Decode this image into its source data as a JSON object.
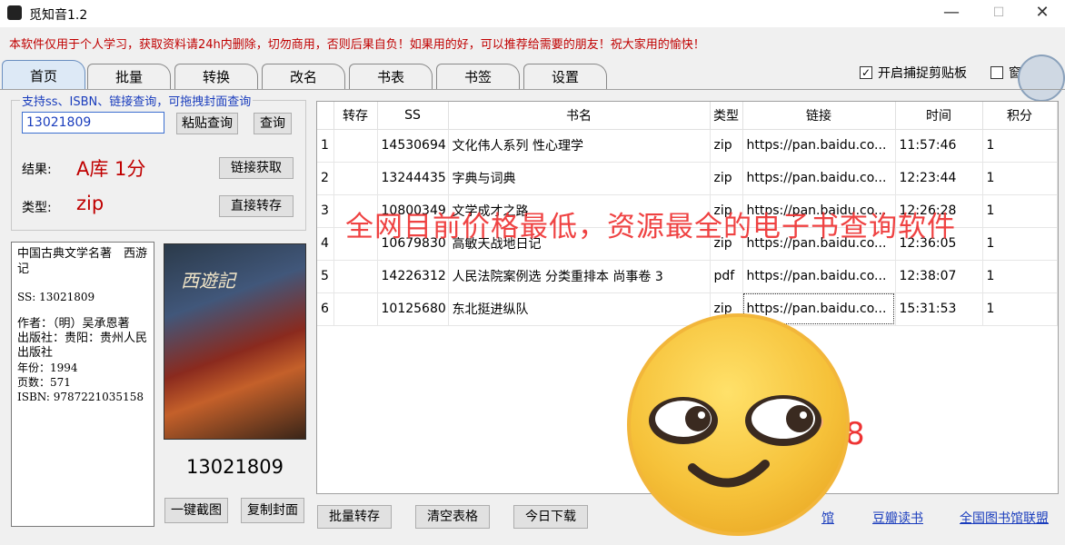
{
  "window": {
    "title": "觅知音1.2",
    "minimize": "—",
    "maximize": "☐",
    "close": "✕"
  },
  "notice": "本软件仅用于个人学习，获取资料请24h内删除，切勿商用，否则后果自负！如果用的好，可以推荐给需要的朋友！祝大家用的愉快！",
  "tabs": [
    {
      "label": "首页"
    },
    {
      "label": "批量"
    },
    {
      "label": "转换"
    },
    {
      "label": "改名"
    },
    {
      "label": "书表"
    },
    {
      "label": "书签"
    },
    {
      "label": "设置"
    }
  ],
  "top_options": {
    "capture_clipboard": "开启捕捉剪贴板",
    "capture_checked": "✓",
    "partial": "窗"
  },
  "query": {
    "legend": "支持ss、ISBN、链接查询，可拖拽封面查询",
    "input_value": "13021809",
    "paste_query": "粘贴查询",
    "query": "查询",
    "result_label": "结果:",
    "result_value": "A库 1分",
    "link_fetch": "链接获取",
    "type_label": "类型:",
    "type_value": "zip",
    "direct_save": "直接转存"
  },
  "book_info": {
    "title": "中国古典文学名著　西游记",
    "ss": "SS: 13021809",
    "author": "作者：（明）吴承恩著",
    "publisher": "出版社：贵阳：贵州人民出版社",
    "year": "年份：1994",
    "pages": "页数：571",
    "isbn": "ISBN: 9787221035158"
  },
  "cover": {
    "title": "西遊記",
    "number": "13021809",
    "screenshot": "一键截图",
    "copy_cover": "复制封面"
  },
  "table": {
    "headers": [
      "",
      "转存",
      "SS",
      "书名",
      "类型",
      "链接",
      "时间",
      "积分"
    ],
    "rows": [
      {
        "n": "1",
        "save": "",
        "ss": "14530694",
        "name": "文化伟人系列  性心理学",
        "type": "zip",
        "link": "https://pan.baidu.co...",
        "time": "11:57:46",
        "points": "1"
      },
      {
        "n": "2",
        "save": "",
        "ss": "13244435",
        "name": "字典与词典",
        "type": "zip",
        "link": "https://pan.baidu.co...",
        "time": "12:23:44",
        "points": "1"
      },
      {
        "n": "3",
        "save": "",
        "ss": "10800349",
        "name": "文学成才之路",
        "type": "zip",
        "link": "https://pan.baidu.co...",
        "time": "12:26:28",
        "points": "1"
      },
      {
        "n": "4",
        "save": "",
        "ss": "10679830",
        "name": "高敏天战地日记",
        "type": "zip",
        "link": "https://pan.baidu.co...",
        "time": "12:36:05",
        "points": "1"
      },
      {
        "n": "5",
        "save": "",
        "ss": "14226312",
        "name": "人民法院案例选  分类重排本  尚事卷  3",
        "type": "pdf",
        "link": "https://pan.baidu.co...",
        "time": "12:38:07",
        "points": "1"
      },
      {
        "n": "6",
        "save": "",
        "ss": "10125680",
        "name": "东北挺进纵队",
        "type": "zip",
        "link": "https://pan.baidu.co...",
        "time": "15:31:53",
        "points": "1"
      }
    ]
  },
  "overlay_text": "全网目前价格最低，资源最全的电子书查询软件",
  "overlay_partial": "8",
  "bottom": {
    "batch_save": "批量转存",
    "clear_table": "清空表格",
    "today_download": "今日下载",
    "link1": "馆",
    "link2": "豆瓣读书",
    "link3": "全国图书馆联盟"
  },
  "colors": {
    "notice": "#c00000",
    "link": "#1a3dbd",
    "overlay": "#e33333"
  }
}
